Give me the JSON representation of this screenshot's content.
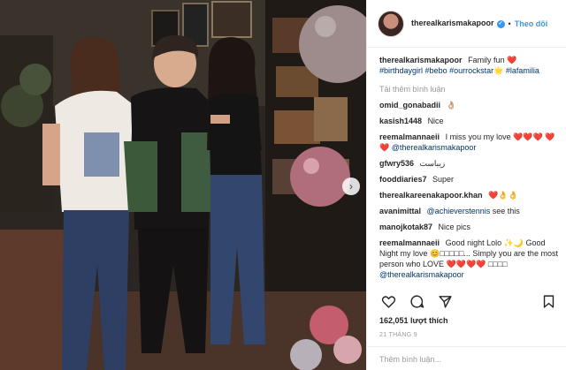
{
  "post": {
    "username": "therealkarismakapoor",
    "follow_label": "Theo dõi",
    "caption": "Family fun ❤️",
    "hashtags": [
      "#birthdaygirl",
      "#bebo",
      "#ourrockstar",
      "#lafamilia"
    ],
    "hashtag_suffix": "🌟"
  },
  "load_more": "Tải thêm bình luận",
  "comments": [
    {
      "user": "omid_gonabadii",
      "text": "👌🏼"
    },
    {
      "user": "kasish1448",
      "text": "Nice"
    },
    {
      "user": "reemalmannaeii",
      "text": "I miss you my love ❤️❤️❤️ ❤️❤️",
      "mention": "@therealkarismakapoor"
    },
    {
      "user": "gfwry536",
      "text": "زیباست"
    },
    {
      "user": "fooddiaries7",
      "text": "Super"
    },
    {
      "user": "therealkareenakapoor.khan",
      "text": "❤️👌👌"
    },
    {
      "user": "avanimittal",
      "mention": "@achieverstennis",
      "text": "see this"
    },
    {
      "user": "manojkotak87",
      "text": "Nice pics"
    },
    {
      "user": "reemalmannaeii",
      "text": "Good night Lolo ✨🌙 Good Night my love 😊□□□□□... Simply you are the most person who LOVE ❤️❤️❤️❤️ □□□□",
      "mention": "@therealkarismakapoor"
    }
  ],
  "likes": "162,051 lượt thích",
  "date": "21 THÁNG 9",
  "add_comment_placeholder": "Thêm bình luận...",
  "icons": {
    "like": "heart-icon",
    "comment": "comment-icon",
    "share": "share-icon",
    "save": "bookmark-icon",
    "next": "chevron-right-icon",
    "verified": "verified-badge-icon"
  },
  "colors": {
    "link": "#003569",
    "follow": "#3897f0",
    "muted": "#999999",
    "heart": "#c8102e"
  }
}
